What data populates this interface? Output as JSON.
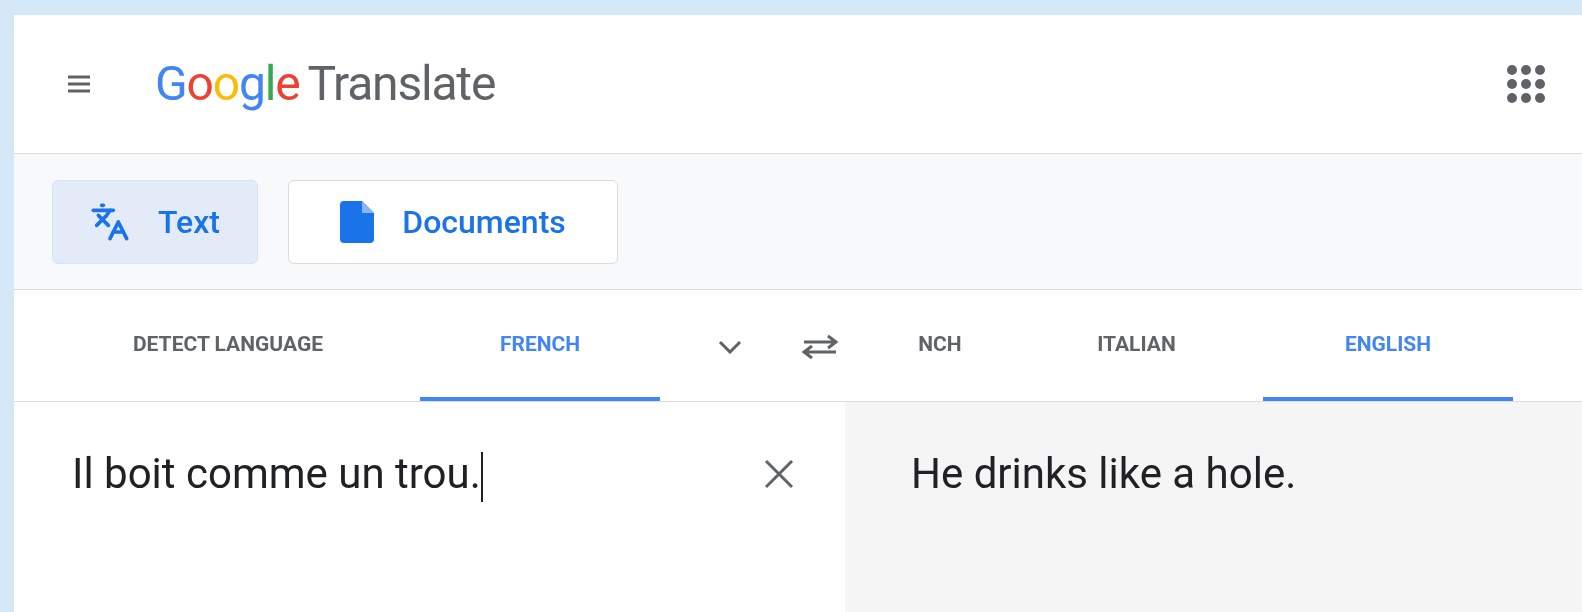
{
  "header": {
    "logo_letters": [
      {
        "char": "G",
        "color": "#4285f4"
      },
      {
        "char": "o",
        "color": "#ea4335"
      },
      {
        "char": "o",
        "color": "#fbbc05"
      },
      {
        "char": "g",
        "color": "#4285f4"
      },
      {
        "char": "l",
        "color": "#34a853"
      },
      {
        "char": "e",
        "color": "#ea4335"
      }
    ],
    "product": "Translate"
  },
  "modes": [
    {
      "label": "Text",
      "kind": "text",
      "selected": true
    },
    {
      "label": "Documents",
      "kind": "document",
      "selected": false
    }
  ],
  "source_languages": [
    {
      "label": "DETECT LANGUAGE",
      "selected": false
    },
    {
      "label": "FRENCH",
      "selected": true
    }
  ],
  "target_languages": [
    {
      "label": "NCH",
      "selected": false
    },
    {
      "label": "ITALIAN",
      "selected": false
    },
    {
      "label": "ENGLISH",
      "selected": true
    }
  ],
  "source": {
    "value": "Il boit comme un trou."
  },
  "translation": {
    "text": "He drinks like a hole."
  }
}
